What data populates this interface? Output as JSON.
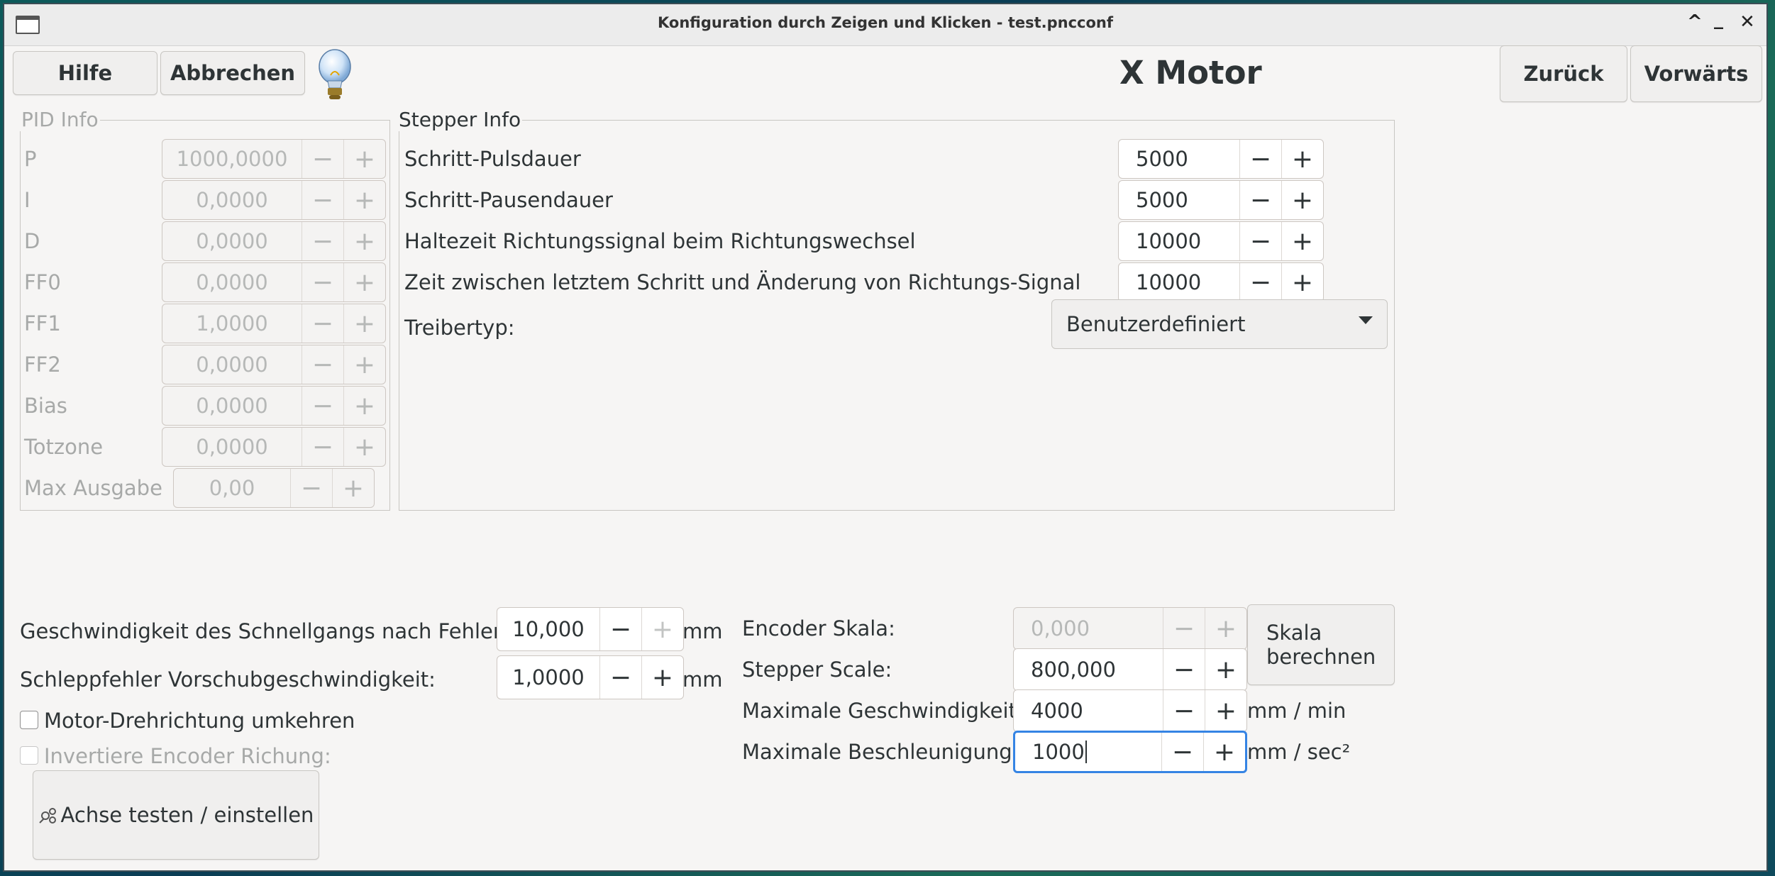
{
  "window": {
    "title": "Konfiguration durch Zeigen und Klicken - test.pncconf",
    "controls": [
      "^",
      "_",
      "✕"
    ]
  },
  "toolbar": {
    "help": "Hilfe",
    "cancel": "Abbrechen",
    "heading": "X Motor",
    "back": "Zurück",
    "forward": "Vorwärts"
  },
  "pid": {
    "title": "PID Info",
    "rows": [
      {
        "label": "P",
        "value": "1000,0000"
      },
      {
        "label": "I",
        "value": "0,0000"
      },
      {
        "label": "D",
        "value": "0,0000"
      },
      {
        "label": "FF0",
        "value": "0,0000"
      },
      {
        "label": "FF1",
        "value": "1,0000"
      },
      {
        "label": "FF2",
        "value": "0,0000"
      },
      {
        "label": "Bias",
        "value": "0,0000"
      },
      {
        "label": "Totzone",
        "value": "0,0000"
      },
      {
        "label": "Max Ausgabe",
        "value": "0,00"
      }
    ]
  },
  "stepper": {
    "title": "Stepper Info",
    "rows": [
      {
        "label": "Schritt-Pulsdauer",
        "value": "5000"
      },
      {
        "label": "Schritt-Pausendauer",
        "value": "5000"
      },
      {
        "label": "Haltezeit Richtungssignal beim Richtungswechsel",
        "value": "10000"
      },
      {
        "label": "Zeit zwischen letztem Schritt und Änderung von Richtungs-Signal",
        "value": "10000"
      }
    ],
    "driver_label": "Treibertyp:",
    "driver_value": "Benutzerdefiniert"
  },
  "bottom": {
    "rapid_label": "Geschwindigkeit des Schnellgangs nach Fehler:",
    "rapid_value": "10,000",
    "rapid_unit": "mm",
    "ferror_label": "Schleppfehler Vorschubgeschwindigkeit:",
    "ferror_value": "1,0000",
    "ferror_unit": "mm",
    "reverse_label": "Motor-Drehrichtung umkehren",
    "invert_encoder_label": "Invertiere Encoder Richung:",
    "test_button": "Achse testen / einstellen",
    "encoder_scale_label": "Encoder Skala:",
    "encoder_scale_value": "0,000",
    "stepper_scale_label": "Stepper Scale:",
    "stepper_scale_value": "800,000",
    "calc_scale_line1": "Skala",
    "calc_scale_line2": "berechnen",
    "max_vel_label": "Maximale Geschwindigkeit:",
    "max_vel_value": "4000",
    "max_vel_unit": "mm / min",
    "max_acc_label": "Maximale Beschleunigung:",
    "max_acc_value": "1000",
    "max_acc_unit": "mm / sec²"
  },
  "colors": {
    "accent": "#3584e4",
    "window_bg": "#f6f5f4",
    "disabled_text": "#a7a9a8"
  }
}
